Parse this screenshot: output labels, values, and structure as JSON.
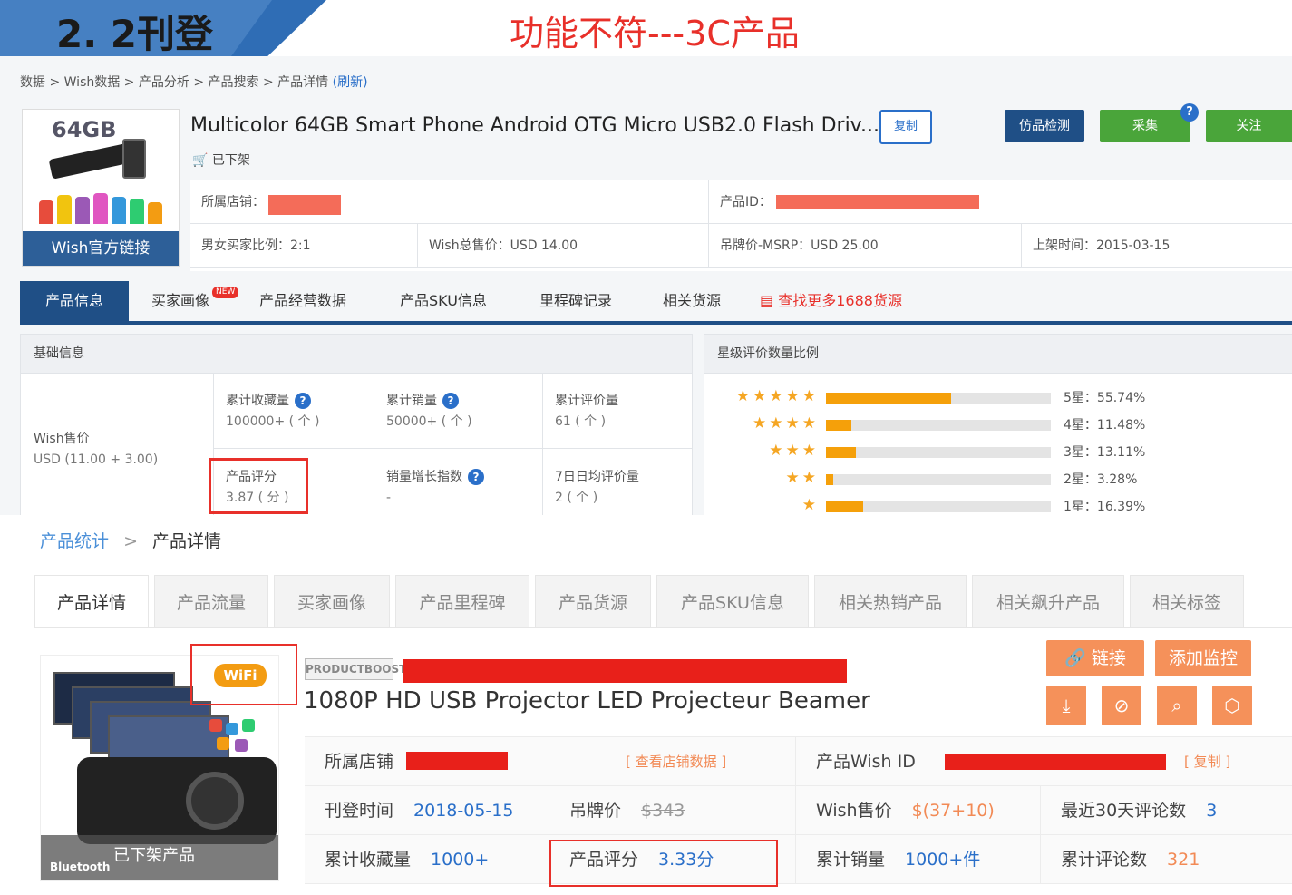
{
  "slide": {
    "title": "2. 2刊登",
    "subtitle": "功能不符---3C产品"
  },
  "upper": {
    "breadcrumb": [
      "数据",
      "Wish数据",
      "产品分析",
      "产品搜索",
      "产品详情"
    ],
    "refresh_label": "(刷新)",
    "thumbnail": {
      "capacity_text": "64GB",
      "link_label": "Wish官方链接"
    },
    "product_title": "Multicolor 64GB Smart Phone Android OTG Micro USB2.0 Flash Driv...",
    "copy_label": "复制",
    "status": "已下架",
    "buttons": {
      "fake_check": "仿品检测",
      "collect": "采集",
      "help": "?",
      "follow": "关注"
    },
    "info": {
      "shop_label": "所属店铺：",
      "product_id_label": "产品ID：",
      "gender_ratio": "男女买家比例：2:1",
      "total_price": "Wish总售价：USD 14.00",
      "msrp": "吊牌价-MSRP：USD 25.00",
      "listed_date": "上架时间：2015-03-15"
    },
    "tabs": [
      {
        "label": "产品信息"
      },
      {
        "label": "买家画像",
        "badge": "NEW"
      },
      {
        "label": "产品经营数据"
      },
      {
        "label": "产品SKU信息"
      },
      {
        "label": "里程碑记录"
      },
      {
        "label": "相关货源"
      },
      {
        "label": "查找更多1688货源"
      }
    ],
    "basic_panel": {
      "title": "基础信息",
      "wish_price_label": "Wish售价",
      "wish_price_value": "USD (11.00 + 3.00)",
      "cells": [
        {
          "label": "累计收藏量",
          "value": "100000+ ( 个 )",
          "help": true
        },
        {
          "label": "累计销量",
          "value": "50000+ ( 个 )",
          "help": true
        },
        {
          "label": "累计评价量",
          "value": "61 ( 个 )",
          "help": false
        },
        {
          "label": "产品评分",
          "value": "3.87 ( 分 )",
          "help": false
        },
        {
          "label": "销量增长指数",
          "value": "-",
          "help": true
        },
        {
          "label": "7日日均评价量",
          "value": "2 ( 个 )",
          "help": false
        }
      ]
    },
    "rating_panel": {
      "title": "星级评价数量比例",
      "rows": [
        {
          "stars": 5,
          "label": "5星：55.74%",
          "percent": 55.74
        },
        {
          "stars": 4,
          "label": "4星：11.48%",
          "percent": 11.48
        },
        {
          "stars": 3,
          "label": "3星：13.11%",
          "percent": 13.11
        },
        {
          "stars": 2,
          "label": "2星：3.28%",
          "percent": 3.28
        },
        {
          "stars": 1,
          "label": "1星：16.39%",
          "percent": 16.39
        }
      ]
    }
  },
  "lower": {
    "breadcrumb": {
      "link": "产品统计",
      "sep": ">",
      "current": "产品详情"
    },
    "tabs": [
      "产品详情",
      "产品流量",
      "买家画像",
      "产品里程碑",
      "产品货源",
      "产品SKU信息",
      "相关热销产品",
      "相关飙升产品",
      "相关标签"
    ],
    "thumbnail": {
      "delisted_label": "已下架产品",
      "bluetooth_label": "Bluetooth",
      "wifi_label": "WiFi"
    },
    "productboost_label": "PRODUCTBOOST",
    "product_title": "1080P HD USB Projector LED Projecteur Beamer",
    "buttons": {
      "link": "链接",
      "monitor": "添加监控"
    },
    "icons": [
      "download-icon",
      "no-sign-icon",
      "zoom-icon",
      "box-icon"
    ],
    "grid": {
      "shop_label": "所属店铺",
      "view_shop": "[ 查看店铺数据 ]",
      "wish_id_label": "产品Wish ID",
      "copy": "[ 复制 ]",
      "listed_label": "刊登时间",
      "listed_value": "2018-05-15",
      "msrp_label": "吊牌价",
      "msrp_value": "$343",
      "price_label": "Wish售价",
      "price_value": "$(37+10)",
      "reviews30_label": "最近30天评论数",
      "reviews30_value": "3",
      "fav_label": "累计收藏量",
      "fav_value": "1000+",
      "score_label": "产品评分",
      "score_value": "3.33分",
      "sales_label": "累计销量",
      "sales_value": "1000+件",
      "reviews_label": "累计评论数",
      "reviews_value": "321"
    }
  },
  "colors": {
    "navy": "#1f4f86",
    "green": "#4aa53a",
    "orange_button": "#f5915a",
    "red_highlight": "#e8302a",
    "star": "#f5a00a"
  }
}
